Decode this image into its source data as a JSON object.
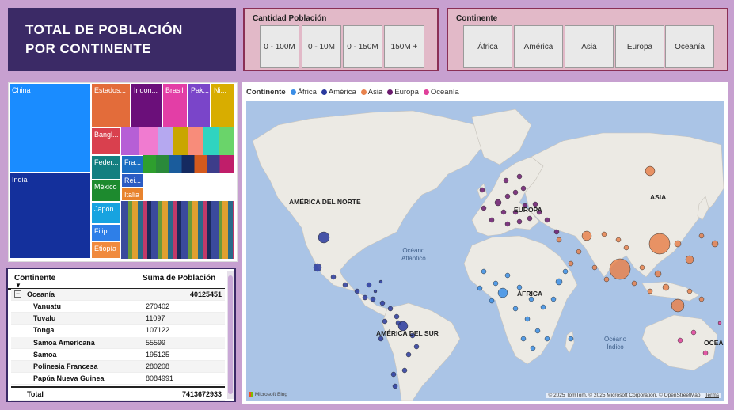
{
  "title": {
    "line1": "TOTAL DE POBLACIÓN",
    "line2": "POR CONTINENTE"
  },
  "slicer_cantidad": {
    "label": "Cantidad Población",
    "options": [
      "0 - 100M",
      "0 - 10M",
      "0 - 150M",
      "150M +"
    ]
  },
  "slicer_continente": {
    "label": "Continente",
    "options": [
      "África",
      "América",
      "Asia",
      "Europa",
      "Oceanía"
    ]
  },
  "treemap": {
    "labels": {
      "china": "China",
      "india": "India",
      "estados": "Estados...",
      "indon": "Indon...",
      "brasil": "Brasil",
      "pak": "Pak...",
      "ni": "Ni...",
      "bangl": "Bangl...",
      "feder": "Feder...",
      "fra": "Fra...",
      "rei": "Rei...",
      "italia": "Italia",
      "mexico": "México",
      "japon": "Japón",
      "filipi": "Filipi...",
      "etiopia": "Etiopía"
    }
  },
  "table": {
    "col_continent": "Continente",
    "col_sum": "Suma de Población",
    "group": {
      "name": "Oceanía",
      "value": "40125451"
    },
    "rows": [
      {
        "name": "Vanuatu",
        "value": "270402"
      },
      {
        "name": "Tuvalu",
        "value": "11097"
      },
      {
        "name": "Tonga",
        "value": "107122"
      },
      {
        "name": "Samoa Americana",
        "value": "55599"
      },
      {
        "name": "Samoa",
        "value": "195125"
      },
      {
        "name": "Polinesia Francesa",
        "value": "280208"
      },
      {
        "name": "Papúa Nueva Guinea",
        "value": "8084991"
      }
    ],
    "total_label": "Total",
    "total_value": "7413672933"
  },
  "map": {
    "legend_title": "Continente",
    "legend": [
      "África",
      "América",
      "Asia",
      "Europa",
      "Oceanía"
    ],
    "colors": {
      "africa": "#3a8ee6",
      "america": "#2a3a9e",
      "asia": "#e8834e",
      "europa": "#6b1a6e",
      "oceania": "#e0409a"
    },
    "labels": {
      "na": "AMÉRICA DEL NORTE",
      "sa": "AMÉRICA DEL SUR",
      "eu": "EUROPA",
      "af": "ÁFRICA",
      "as": "ASIA",
      "oc": "OCEANÍ"
    },
    "oceans": {
      "atl1": "Océano",
      "atl2": "Atlántico",
      "ind1": "Océano",
      "ind2": "Índico"
    },
    "bing": "Microsoft Bing",
    "copyright": "© 2025 TomTom, © 2025 Microsoft Corporation, © OpenStreetMap",
    "terms": "Terms"
  }
}
